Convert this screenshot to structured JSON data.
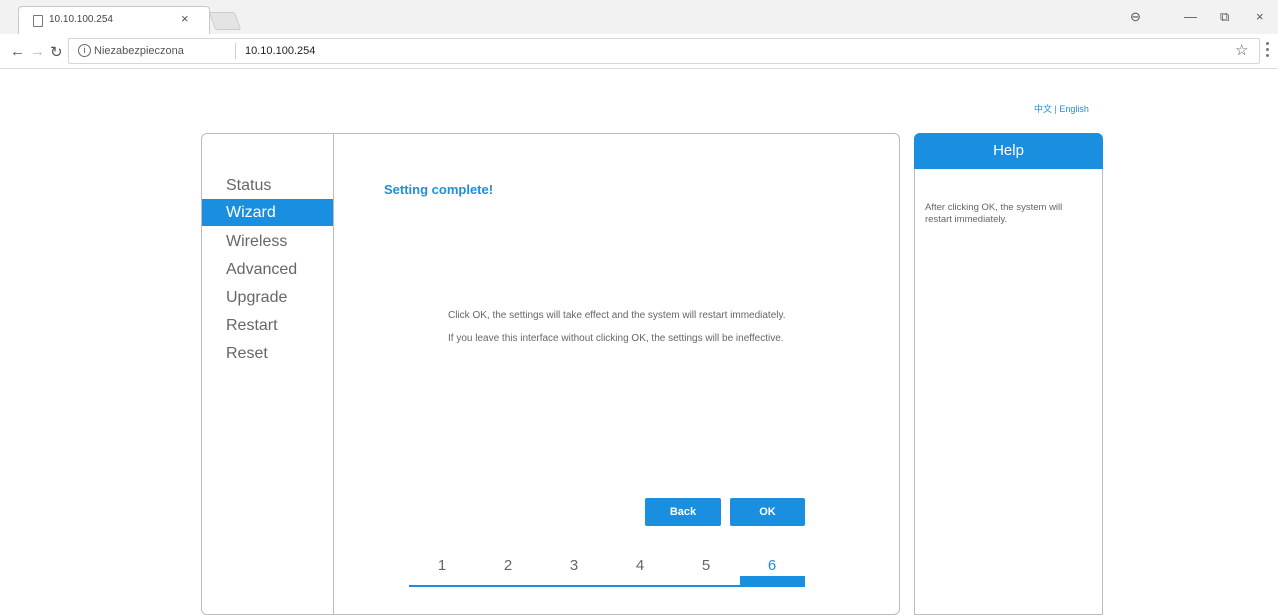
{
  "browser": {
    "tab_title": "10.10.100.254",
    "tab_close": "×",
    "security_label": "Niezabezpieczona",
    "url": "10.10.100.254",
    "controls": {
      "account": "⊖",
      "minimize": "—",
      "restore": "⧉",
      "close": "×"
    }
  },
  "lang": {
    "chinese": "中文",
    "separator": " | ",
    "english": "English"
  },
  "sidebar": {
    "items": [
      {
        "label": "Status",
        "active": false
      },
      {
        "label": "Wizard",
        "active": true
      },
      {
        "label": "Wireless",
        "active": false
      },
      {
        "label": "Advanced",
        "active": false
      },
      {
        "label": "Upgrade",
        "active": false
      },
      {
        "label": "Restart",
        "active": false
      },
      {
        "label": "Reset",
        "active": false
      }
    ]
  },
  "main": {
    "title": "Setting complete!",
    "message_1": "Click OK, the settings will take effect and the system will restart immediately.",
    "message_2": "If you leave this interface without clicking OK, the settings will be ineffective.",
    "back_label": "Back",
    "ok_label": "OK",
    "steps": [
      "1",
      "2",
      "3",
      "4",
      "5",
      "6"
    ],
    "current_step": 6
  },
  "help": {
    "title": "Help",
    "text": "After clicking OK, the system will restart immediately."
  },
  "colors": {
    "accent": "#1a8fe0",
    "border": "#bcbcbc",
    "text": "#666666"
  },
  "icons": {
    "back": "back-arrow-icon",
    "forward": "forward-arrow-icon",
    "reload": "reload-icon",
    "info": "info-icon",
    "star": "star-icon",
    "page": "page-icon"
  }
}
